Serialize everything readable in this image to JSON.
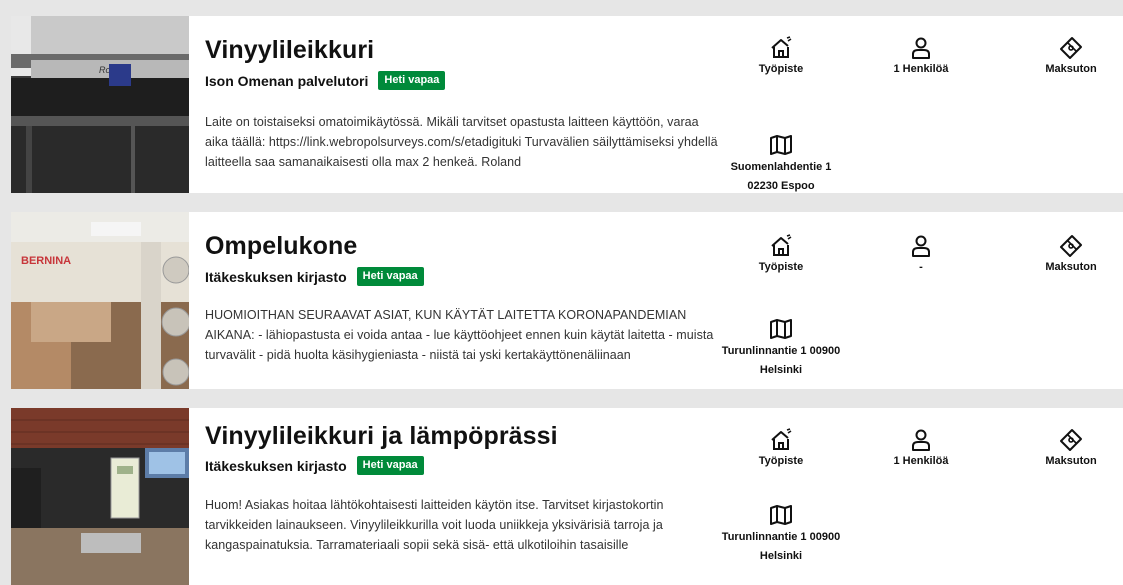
{
  "resources": [
    {
      "title": "Vinyylileikkuri",
      "provider": "Ison Omenan palvelutori",
      "badge": "Heti vapaa",
      "description": "Laite on toistaiseksi omatoimikäytössä. Mikäli tarvitset opastusta laitteen käyttöön, varaa aika täällä: https://link.webropolsurveys.com/s/etadigituki Turvavälien säilyttämiseksi yhdellä laitteella saa samanaikaisesti olla max 2 henkeä. Roland",
      "type_label": "Työpiste",
      "persons_label": "1 Henkilöä",
      "price_label": "Maksuton",
      "address_line1": "Suomenlahdentie 1",
      "address_line2": "02230 Espoo",
      "thumb_icon": "vinyl-cutter-photo"
    },
    {
      "title": "Ompelukone",
      "provider": "Itäkeskuksen kirjasto",
      "badge": "Heti vapaa",
      "description": "HUOMIOITHAN SEURAAVAT ASIAT, KUN KÄYTÄT LAITETTA KORONAPANDEMIAN AIKANA: - lähiopastusta ei voida antaa - lue käyttöohjeet ennen kuin käytät laitetta - muista turvavälit - pidä huolta käsihygieniasta - niistä tai yski kertakäyttönenäliinaan",
      "type_label": "Työpiste",
      "persons_label": "-",
      "price_label": "Maksuton",
      "address_line1": "Turunlinnantie 1 00900",
      "address_line2": "Helsinki",
      "thumb_icon": "sewing-machine-photo"
    },
    {
      "title": "Vinyylileikkuri ja lämpöprässi",
      "provider": "Itäkeskuksen kirjasto",
      "badge": "Heti vapaa",
      "description": "Huom! Asiakas hoitaa lähtökohtaisesti laitteiden käytön itse. Tarvitset kirjastokortin tarvikkeiden lainaukseen. Vinyylileikkurilla voit luoda uniikkeja yksivärisiä tarroja ja kangaspainatuksia. Tarramateriaali sopii sekä sisä- että ulkotiloihin tasaisille",
      "type_label": "Työpiste",
      "persons_label": "1 Henkilöä",
      "price_label": "Maksuton",
      "address_line1": "Turunlinnantie 1 00900",
      "address_line2": "Helsinki",
      "thumb_icon": "vinyl-cutter-heat-press-photo"
    }
  ],
  "thumb_brand_1": "Roland",
  "thumb_brand_2": "BERNINA",
  "colors": {
    "badge": "#008a3a",
    "card": "#ffffff",
    "background": "#e6e6e6"
  }
}
